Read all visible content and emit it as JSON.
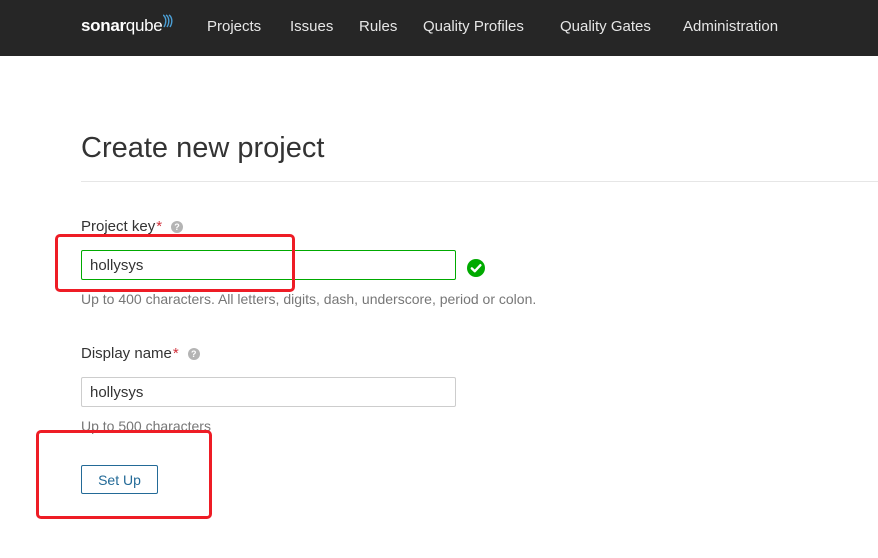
{
  "navbar": {
    "logo": {
      "text_bold": "sonar",
      "text_light": "qube"
    },
    "items": [
      {
        "label": "Projects"
      },
      {
        "label": "Issues"
      },
      {
        "label": "Rules"
      },
      {
        "label": "Quality Profiles"
      },
      {
        "label": "Quality Gates"
      },
      {
        "label": "Administration"
      }
    ]
  },
  "page": {
    "title": "Create new project"
  },
  "form": {
    "project_key": {
      "label": "Project key",
      "required_marker": "*",
      "help_icon": "?",
      "value": "hollysys",
      "status_icon": "check-circle-icon",
      "hint": "Up to 400 characters. All letters, digits, dash, underscore, period or colon."
    },
    "display_name": {
      "label": "Display name",
      "required_marker": "*",
      "help_icon": "?",
      "value": "hollysys",
      "hint": "Up to 500 characters"
    },
    "submit_label": "Set Up"
  },
  "colors": {
    "navbar_bg": "#262626",
    "valid_green": "#00aa00",
    "button_blue": "#236a97",
    "required_red": "#d02f3a",
    "annotation_red": "#ee1c25"
  }
}
